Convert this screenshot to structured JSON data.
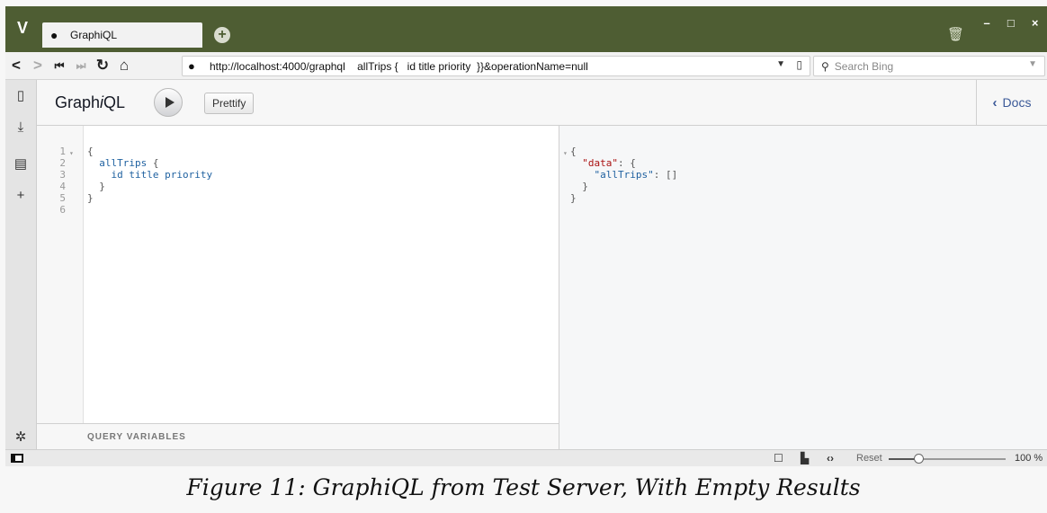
{
  "browser": {
    "menu_icon": "vivaldi-logo-icon",
    "tab": {
      "title": "GraphiQL",
      "favicon": "globe-icon"
    },
    "new_tab_icon": "plus-icon",
    "trash_icon": "trash-icon",
    "window_controls": [
      "minimize-icon",
      "maximize-icon",
      "close-icon"
    ],
    "nav": [
      "back-icon",
      "forward-icon",
      "rewind-icon",
      "fast-forward-icon",
      "reload-icon",
      "home-icon"
    ],
    "url": "http://localhost:4000/graphql    allTrips {   id title priority  }}&operationName=null",
    "search_placeholder": "Search Bing"
  },
  "side_panel": {
    "icons": [
      "bookmarks-icon",
      "downloads-icon",
      "notes-icon",
      "add-panel-icon",
      "settings-icon"
    ]
  },
  "graphiql": {
    "title_pre": "Graph",
    "title_i": "i",
    "title_post": "QL",
    "execute_icon": "play-icon",
    "prettify_label": "Prettify",
    "docs_label": "Docs",
    "query_variables_label": "QUERY VARIABLES",
    "query_lines": [
      {
        "num": "1",
        "text": "{"
      },
      {
        "num": "2",
        "text": "  allTrips {"
      },
      {
        "num": "3",
        "text": "    id title priority"
      },
      {
        "num": "4",
        "text": "  }"
      },
      {
        "num": "5",
        "text": "}"
      },
      {
        "num": "6",
        "text": ""
      }
    ],
    "result_lines": [
      "{",
      "  \"data\": {",
      "    \"allTrips\": []",
      "  }",
      "}"
    ]
  },
  "status_bar": {
    "reset_label": "Reset",
    "zoom_label": "100 %",
    "zoom_fraction": 0.25
  },
  "caption": "Figure 11: GraphiQL from Test Server, With Empty Results"
}
